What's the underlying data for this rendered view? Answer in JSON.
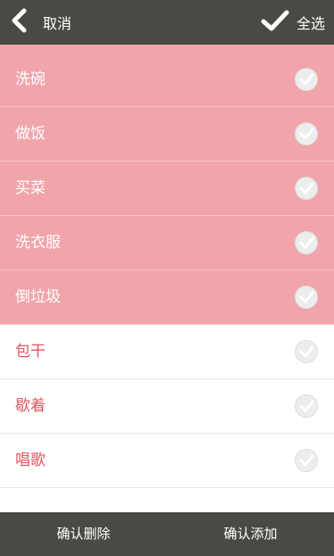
{
  "topbar": {
    "cancel_label": "取消",
    "select_all_label": "全选"
  },
  "items": [
    {
      "label": "洗碗",
      "selected": true
    },
    {
      "label": "做饭",
      "selected": true
    },
    {
      "label": "买菜",
      "selected": true
    },
    {
      "label": "洗衣服",
      "selected": true
    },
    {
      "label": "倒垃圾",
      "selected": true
    },
    {
      "label": "包干",
      "selected": false
    },
    {
      "label": "歇着",
      "selected": false
    },
    {
      "label": "唱歌",
      "selected": false
    }
  ],
  "bottombar": {
    "confirm_delete_label": "确认删除",
    "confirm_add_label": "确认添加"
  },
  "colors": {
    "bar": "#4a4a45",
    "selected_row": "#f2a4ab",
    "unselected_text": "#e05360"
  }
}
